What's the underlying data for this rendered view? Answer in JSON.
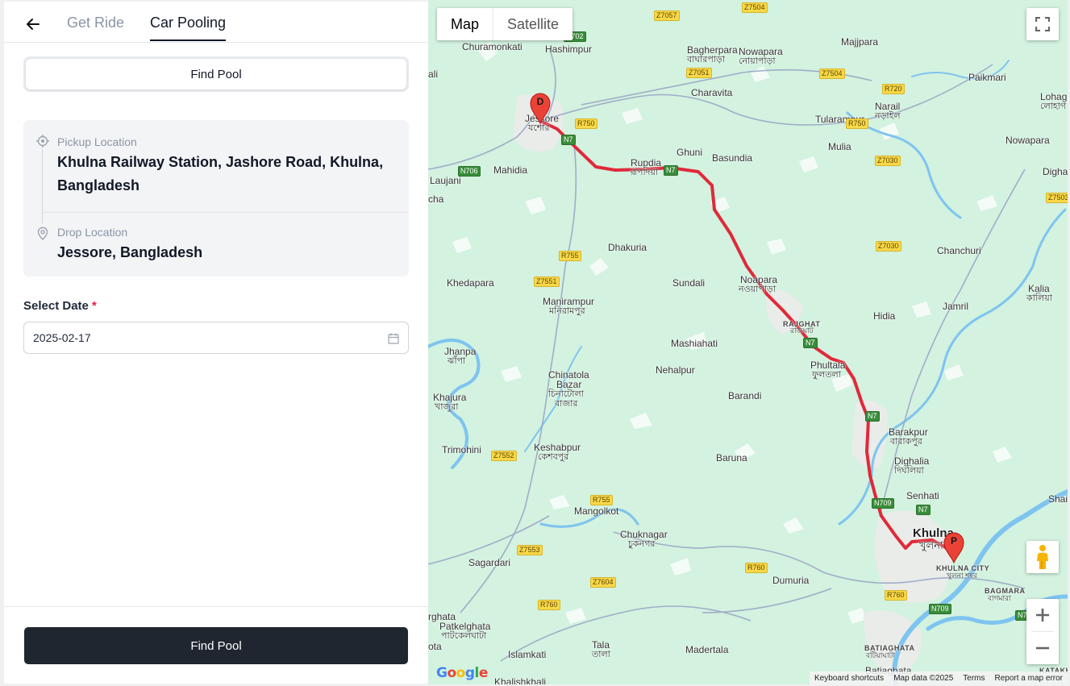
{
  "tabs": {
    "back_icon": "arrow-left-icon",
    "get_ride": "Get Ride",
    "car_pooling": "Car Pooling",
    "active": "car_pooling"
  },
  "segment": {
    "label": "Find Pool"
  },
  "pickup": {
    "label": "Pickup Location",
    "value": "Khulna Railway Station, Jashore Road, Khulna, Bangladesh",
    "icon": "location-target-icon"
  },
  "drop": {
    "label": "Drop Location",
    "value": "Jessore, Bangladesh",
    "icon": "map-pin-icon"
  },
  "date": {
    "label": "Select Date",
    "required_mark": "*",
    "value": "2025-02-17",
    "icon": "calendar-icon"
  },
  "footer": {
    "button_label": "Find Pool"
  },
  "colors": {
    "primary_dark": "#1f2630",
    "route": "#e0293a",
    "required": "#e11d48",
    "water": "#7ec4f0",
    "land": "#d3f2df"
  },
  "map": {
    "type_buttons": [
      "Map",
      "Satellite"
    ],
    "selected_type": "Map",
    "markers": {
      "start": "D",
      "end": "P"
    },
    "logo": "Google",
    "attribution": [
      "Keyboard shortcuts",
      "Map data ©2025",
      "Terms",
      "Report a map error"
    ],
    "controls": {
      "fullscreen": "fullscreen-icon",
      "street_view": "pegman-icon",
      "zoom_in": "+",
      "zoom_out": "−"
    },
    "places": [
      "Churamonkati",
      "Hashimpur",
      "Jessore",
      "যশোর",
      "Laujani",
      "Mahidia",
      "ali",
      "cha",
      "Rupdia",
      "রূপদিয়া",
      "Ghuni",
      "Basundia",
      "Bagherpara",
      "বাঘারপাড়া",
      "Nowapara",
      "নোয়াপাড়া",
      "Charavita",
      "Majjpara",
      "Paikmari",
      "Narail",
      "নড়াইল",
      "Tularampur",
      "Mulia",
      "Nowapara",
      "Digha",
      "Lohago",
      "লোহাগ",
      "Dhakuria",
      "Chanchuri",
      "Khedapara",
      "Sundali",
      "Noapara",
      "নওয়াপাড়া",
      "Manirampur",
      "মনিরামপুর",
      "Kalia",
      "কালিয়া",
      "Jamril",
      "Hidia",
      "RAJGHAT",
      "রাজঘাট",
      "Jhanpa",
      "ঝাঁপা",
      "Mashiahati",
      "Nehalpur",
      "Phultala",
      "ফুলতলা",
      "Chinatola",
      "Bazar",
      "চিনাটোলা",
      "বাজার",
      "Barandi",
      "Khajura",
      "খাজুরা",
      "Barakpur",
      "বারাকপুর",
      "Trimohini",
      "Keshabpur",
      "কেশবপুর",
      "Dighalia",
      "দিঘলিয়া",
      "Baruna",
      "Senhati",
      "Shai",
      "Mangolkot",
      "Khulna",
      "খুলনা",
      "Chuknagar",
      "চুকনগর",
      "KHULNA CITY",
      "খুলনা শহর",
      "Sagardari",
      "Dumuria",
      "BAGMARA",
      "বাগমারা",
      "rghata",
      "Patkelghata",
      "পাটকেলঘাটা",
      "Tala",
      "তালা",
      "Madertala",
      "Islamkati",
      "ota",
      "BATIAGHATA",
      "বটিয়াঘাটা",
      "Batiaghata",
      "Khalishkhali",
      "KATAKH"
    ],
    "road_shields": [
      "Z7057",
      "Z7504",
      "N702",
      "Z7051",
      "Z7504",
      "R720",
      "R750",
      "N7",
      "R750",
      "N706",
      "N7",
      "Z7030",
      "Z7503",
      "R755",
      "Z7030",
      "Z7551",
      "N7",
      "N7",
      "Z7552",
      "R755",
      "N709",
      "N7",
      "Z7553",
      "Z7604",
      "R760",
      "R760",
      "R760",
      "N709",
      "N7"
    ]
  }
}
